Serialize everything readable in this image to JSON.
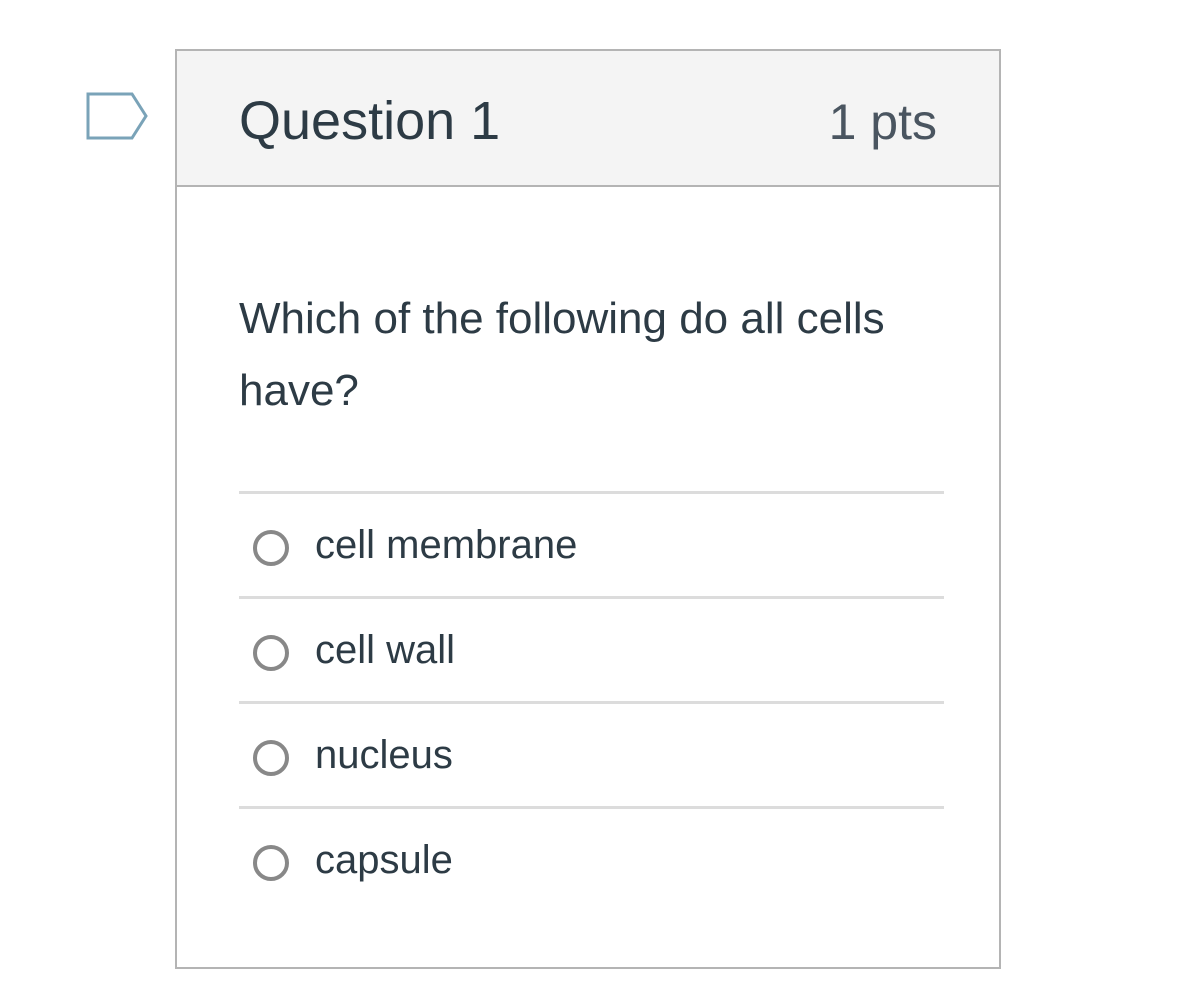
{
  "question": {
    "title": "Question 1",
    "points": "1 pts",
    "text": "Which of the following do all cells have?",
    "flag_icon": "flag-icon",
    "answers": [
      {
        "label": "cell membrane",
        "selected": false
      },
      {
        "label": "cell wall",
        "selected": false
      },
      {
        "label": "nucleus",
        "selected": false
      },
      {
        "label": "capsule",
        "selected": false
      }
    ]
  },
  "colors": {
    "header_bg": "#f4f4f4",
    "border": "#b4b4b4",
    "text": "#2d3b45",
    "flag_stroke": "#7aa3b8",
    "radio_border": "#888888"
  }
}
